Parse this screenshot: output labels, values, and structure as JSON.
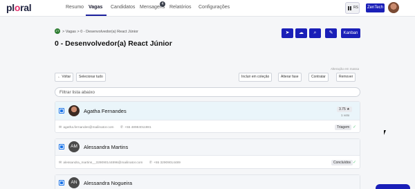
{
  "nav": {
    "logo": "pl",
    "logo_rest": "ral",
    "tabs": [
      {
        "label": "Resumo"
      },
      {
        "label": "Vagas"
      },
      {
        "label": "Candidatos"
      },
      {
        "label": "Mensagens"
      },
      {
        "label": "Relatórios"
      },
      {
        "label": "Configurações"
      }
    ],
    "messages_badge": "4",
    "apps_label": "RS",
    "company": "ZenTech"
  },
  "breadcrumb": {
    "icon_text": "ZT",
    "text": "> Vagas > 0 - Desenvolvedor(a) React Júnior"
  },
  "page_title": "0 - Desenvolvedor(a) React Júnior",
  "header_actions": {
    "kanban": "Kanban",
    "icons": [
      "send-icon",
      "cloud-upload-icon",
      "search-icon",
      "edit-icon"
    ]
  },
  "toolbar": {
    "back": "← Voltar",
    "select_all": "Selecionar tudo",
    "mass_label": "Alteração em massa",
    "include": "Incluir em coleção",
    "change_phase": "Alterar fase",
    "hire": "Contratar",
    "remove": "Remover"
  },
  "filter": {
    "placeholder": "Filtrar lista abaixo"
  },
  "candidates": [
    {
      "name": "Agatha Fernandes",
      "initials": "",
      "rating": "3.75 ★",
      "votes": "1 voto",
      "email": "agatha.fernandes@mailinator.com",
      "phone": "+55 48984011981",
      "phase": "Triagem"
    },
    {
      "name": "Alessandra Martins",
      "initials": "AM",
      "email": "alessandra_martins__329090144896@mailinator.com",
      "phone": "+55 32909014489",
      "phase": "Concluídos"
    },
    {
      "name": "Alessandra Nogueira",
      "initials": "AN"
    }
  ]
}
